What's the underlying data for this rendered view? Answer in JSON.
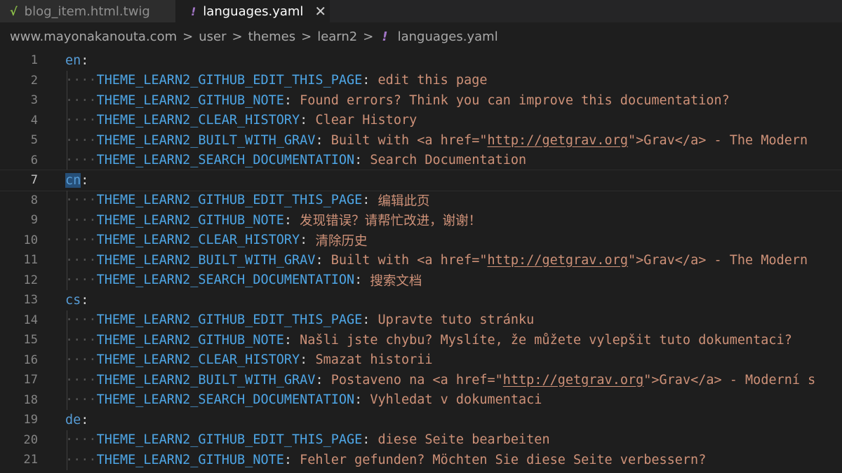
{
  "tabs": [
    {
      "label": "blog_item.html.twig",
      "icon": "twig-file-icon",
      "active": false
    },
    {
      "label": "languages.yaml",
      "icon": "yaml-file-icon",
      "active": true
    }
  ],
  "breadcrumb": {
    "parts": [
      "www.mayonakanouta.com",
      "user",
      "themes",
      "learn2"
    ],
    "file": "languages.yaml",
    "sep": ">"
  },
  "lines": [
    {
      "n": "1",
      "indent": false,
      "key": "en",
      "top": true,
      "segments": []
    },
    {
      "n": "2",
      "indent": true,
      "key": "THEME_LEARN2_GITHUB_EDIT_THIS_PAGE",
      "segments": [
        {
          "t": "edit this page"
        }
      ]
    },
    {
      "n": "3",
      "indent": true,
      "key": "THEME_LEARN2_GITHUB_NOTE",
      "segments": [
        {
          "t": "Found errors? Think you can improve this documentation?"
        }
      ]
    },
    {
      "n": "4",
      "indent": true,
      "key": "THEME_LEARN2_CLEAR_HISTORY",
      "segments": [
        {
          "t": "Clear History"
        }
      ]
    },
    {
      "n": "5",
      "indent": true,
      "key": "THEME_LEARN2_BUILT_WITH_GRAV",
      "segments": [
        {
          "t": "Built with <a href=\""
        },
        {
          "t": "http://getgrav.org",
          "link": true
        },
        {
          "t": "\">Grav</a> - The Modern"
        }
      ]
    },
    {
      "n": "6",
      "indent": true,
      "key": "THEME_LEARN2_SEARCH_DOCUMENTATION",
      "segments": [
        {
          "t": "Search Documentation"
        }
      ]
    },
    {
      "n": "7",
      "indent": false,
      "key": "cn",
      "top": true,
      "current": true,
      "segments": []
    },
    {
      "n": "8",
      "indent": true,
      "key": "THEME_LEARN2_GITHUB_EDIT_THIS_PAGE",
      "segments": [
        {
          "t": "编辑此页"
        }
      ]
    },
    {
      "n": "9",
      "indent": true,
      "key": "THEME_LEARN2_GITHUB_NOTE",
      "segments": [
        {
          "t": "发现错误？请帮忙改进，谢谢！"
        }
      ]
    },
    {
      "n": "10",
      "indent": true,
      "key": "THEME_LEARN2_CLEAR_HISTORY",
      "segments": [
        {
          "t": "清除历史"
        }
      ]
    },
    {
      "n": "11",
      "indent": true,
      "key": "THEME_LEARN2_BUILT_WITH_GRAV",
      "segments": [
        {
          "t": "Built with <a href=\""
        },
        {
          "t": "http://getgrav.org",
          "link": true
        },
        {
          "t": "\">Grav</a> - The Modern"
        }
      ]
    },
    {
      "n": "12",
      "indent": true,
      "key": "THEME_LEARN2_SEARCH_DOCUMENTATION",
      "segments": [
        {
          "t": "搜索文档"
        }
      ]
    },
    {
      "n": "13",
      "indent": false,
      "key": "cs",
      "top": true,
      "segments": []
    },
    {
      "n": "14",
      "indent": true,
      "key": "THEME_LEARN2_GITHUB_EDIT_THIS_PAGE",
      "segments": [
        {
          "t": "Upravte tuto stránku"
        }
      ]
    },
    {
      "n": "15",
      "indent": true,
      "key": "THEME_LEARN2_GITHUB_NOTE",
      "segments": [
        {
          "t": "Našli jste chybu? Myslíte, že můžete vylepšit tuto dokumentaci?"
        }
      ]
    },
    {
      "n": "16",
      "indent": true,
      "key": "THEME_LEARN2_CLEAR_HISTORY",
      "segments": [
        {
          "t": "Smazat historii"
        }
      ]
    },
    {
      "n": "17",
      "indent": true,
      "key": "THEME_LEARN2_BUILT_WITH_GRAV",
      "segments": [
        {
          "t": "Postaveno na <a href=\""
        },
        {
          "t": "http://getgrav.org",
          "link": true
        },
        {
          "t": "\">Grav</a> - Moderní s"
        }
      ]
    },
    {
      "n": "18",
      "indent": true,
      "key": "THEME_LEARN2_SEARCH_DOCUMENTATION",
      "segments": [
        {
          "t": "Vyhledat v dokumentaci"
        }
      ]
    },
    {
      "n": "19",
      "indent": false,
      "key": "de",
      "top": true,
      "segments": []
    },
    {
      "n": "20",
      "indent": true,
      "key": "THEME_LEARN2_GITHUB_EDIT_THIS_PAGE",
      "segments": [
        {
          "t": "diese Seite bearbeiten"
        }
      ]
    },
    {
      "n": "21",
      "indent": true,
      "key": "THEME_LEARN2_GITHUB_NOTE",
      "segments": [
        {
          "t": "Fehler gefunden? Möchten Sie diese Seite verbessern?"
        }
      ]
    }
  ]
}
